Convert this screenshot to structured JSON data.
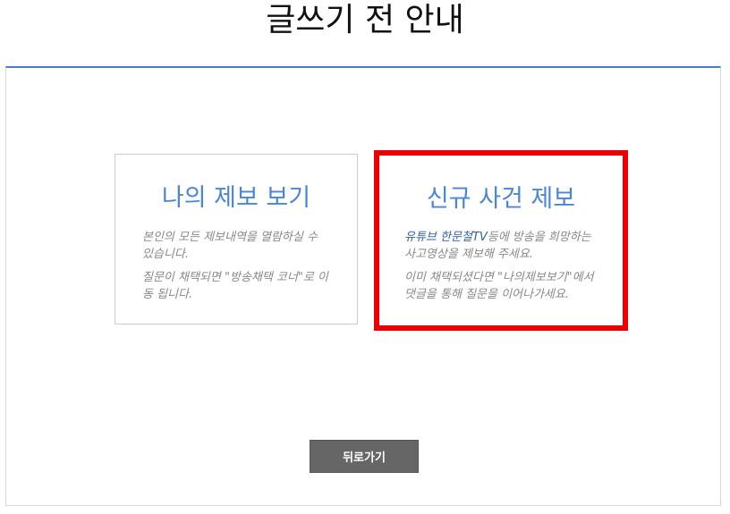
{
  "page": {
    "title": "글쓰기 전 안내"
  },
  "cards": {
    "my_reports": {
      "title": "나의 제보 보기",
      "desc1": "본인의 모든 제보내역을 열람하실 수 있습니다.",
      "desc2": "질문이 채택되면 \"방송채택 코너\"로 이동 됩니다."
    },
    "new_report": {
      "title": "신규 사건 제보",
      "desc1_link": "유튜브 한문철TV",
      "desc1_rest": "등에 방송을 희망하는 사고영상을 제보해 주세요.",
      "desc2": "이미 채택되셨다면 \"나의제보보기\"에서 댓글을 통해 질문을 이어나가세요."
    }
  },
  "buttons": {
    "back_label": "뒤로가기"
  },
  "colors": {
    "accent_blue": "#4a86d8",
    "panel_top_border": "#4a7dc6",
    "highlight_red": "#ee0000",
    "button_gray": "#666666"
  }
}
